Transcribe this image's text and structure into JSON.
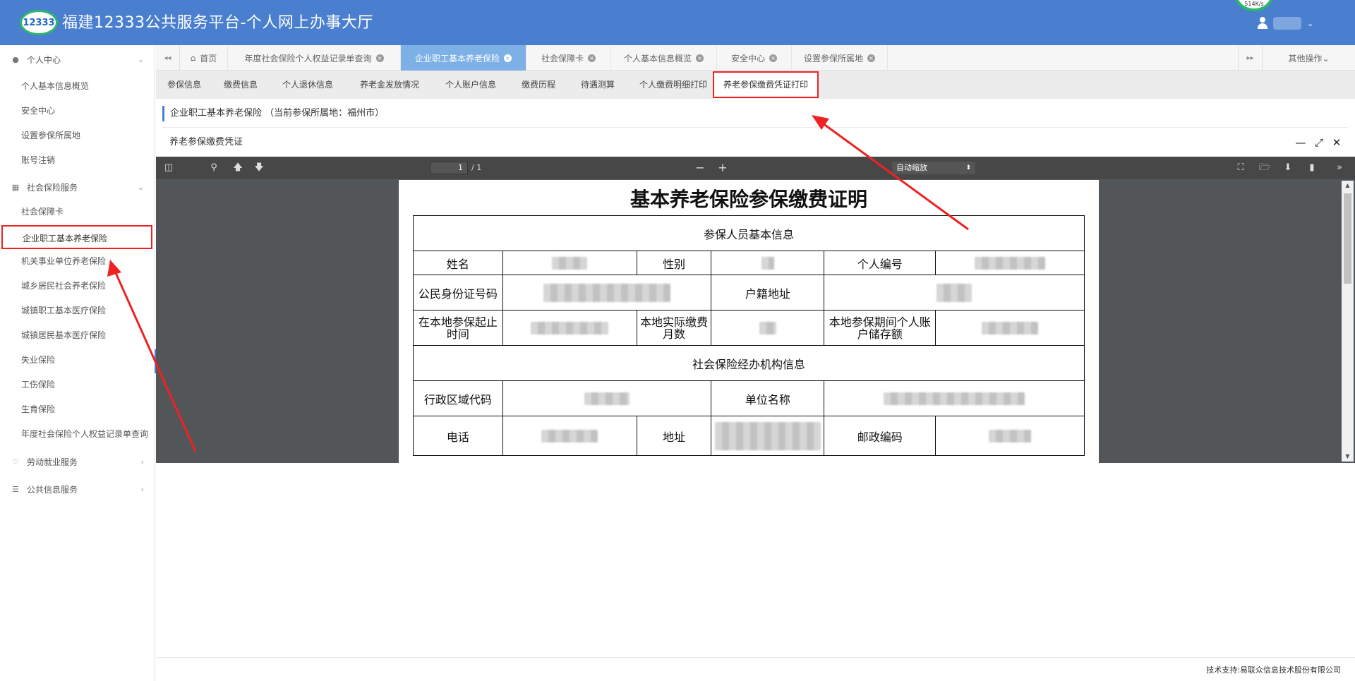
{
  "header": {
    "logo_text": "12333",
    "title": "福建12333公共服务平台-个人网上办事大厅",
    "speed_badge": "514K/s",
    "user_caret": "⌄"
  },
  "sidebar": {
    "groups": [
      {
        "label": "个人中心",
        "icon": "user-icon",
        "arrow": "⌄"
      },
      {
        "label": "社会保险服务",
        "icon": "grid-icon",
        "arrow": "⌄"
      },
      {
        "label": "劳动就业服务",
        "icon": "heart-icon",
        "arrow": "›"
      },
      {
        "label": "公共信息服务",
        "icon": "list-icon",
        "arrow": "›"
      }
    ],
    "personal_items": [
      "个人基本信息概览",
      "安全中心",
      "设置参保所属地",
      "账号注销"
    ],
    "insurance_items": [
      "社会保障卡",
      "企业职工基本养老保险",
      "机关事业单位养老保险",
      "城乡居民社会养老保险",
      "城镇职工基本医疗保险",
      "城镇居民基本医疗保险",
      "失业保险",
      "工伤保险",
      "生育保险",
      "年度社会保险个人权益记录单查询"
    ]
  },
  "tabs": {
    "prev": "◂◂",
    "next": "▸▸",
    "more": "其他操作⌄",
    "home_icon": "home-icon",
    "items": [
      {
        "label": "首页",
        "closable": false
      },
      {
        "label": "年度社会保险个人权益记录单查询",
        "closable": true
      },
      {
        "label": "企业职工基本养老保险",
        "closable": true,
        "active": true
      },
      {
        "label": "社会保障卡",
        "closable": true
      },
      {
        "label": "个人基本信息概览",
        "closable": true
      },
      {
        "label": "安全中心",
        "closable": true
      },
      {
        "label": "设置参保所属地",
        "closable": true
      }
    ],
    "close_glyph": "×"
  },
  "subtabs": [
    "参保信息",
    "缴费信息",
    "个人退休信息",
    "养老金发放情况",
    "个人账户信息",
    "缴费历程",
    "待遇测算",
    "个人缴费明细打印",
    "养老参保缴费凭证打印"
  ],
  "section": {
    "title": "企业职工基本养老保险 （当前参保所属地：福州市）"
  },
  "panel": {
    "title": "养老参保缴费凭证",
    "minimize": "—",
    "maximize": "⤢",
    "close": "✕"
  },
  "pdf_toolbar": {
    "page_current": "1",
    "page_total": "/ 1",
    "zoom_out": "−",
    "zoom_in": "+",
    "zoom_value": "自动缩放",
    "zoom_caret": "⬍"
  },
  "document": {
    "title": "基本养老保险参保缴费证明",
    "section1": "参保人员基本信息",
    "name_label": "姓名",
    "gender_label": "性别",
    "id_no_label": "个人编号",
    "citizen_id_label": "公民身份证号码",
    "household_label": "户籍地址",
    "period_label": "在本地参保起止时间",
    "months_label": "本地实际缴费月数",
    "account_label": "本地参保期间个人账户储存额",
    "section2": "社会保险经办机构信息",
    "region_label": "行政区域代码",
    "unit_label": "单位名称",
    "phone_label": "电话",
    "address_label": "地址",
    "postcode_label": "邮政编码"
  },
  "footer": {
    "text": "技术支持:易联众信息技术股份有限公司"
  }
}
